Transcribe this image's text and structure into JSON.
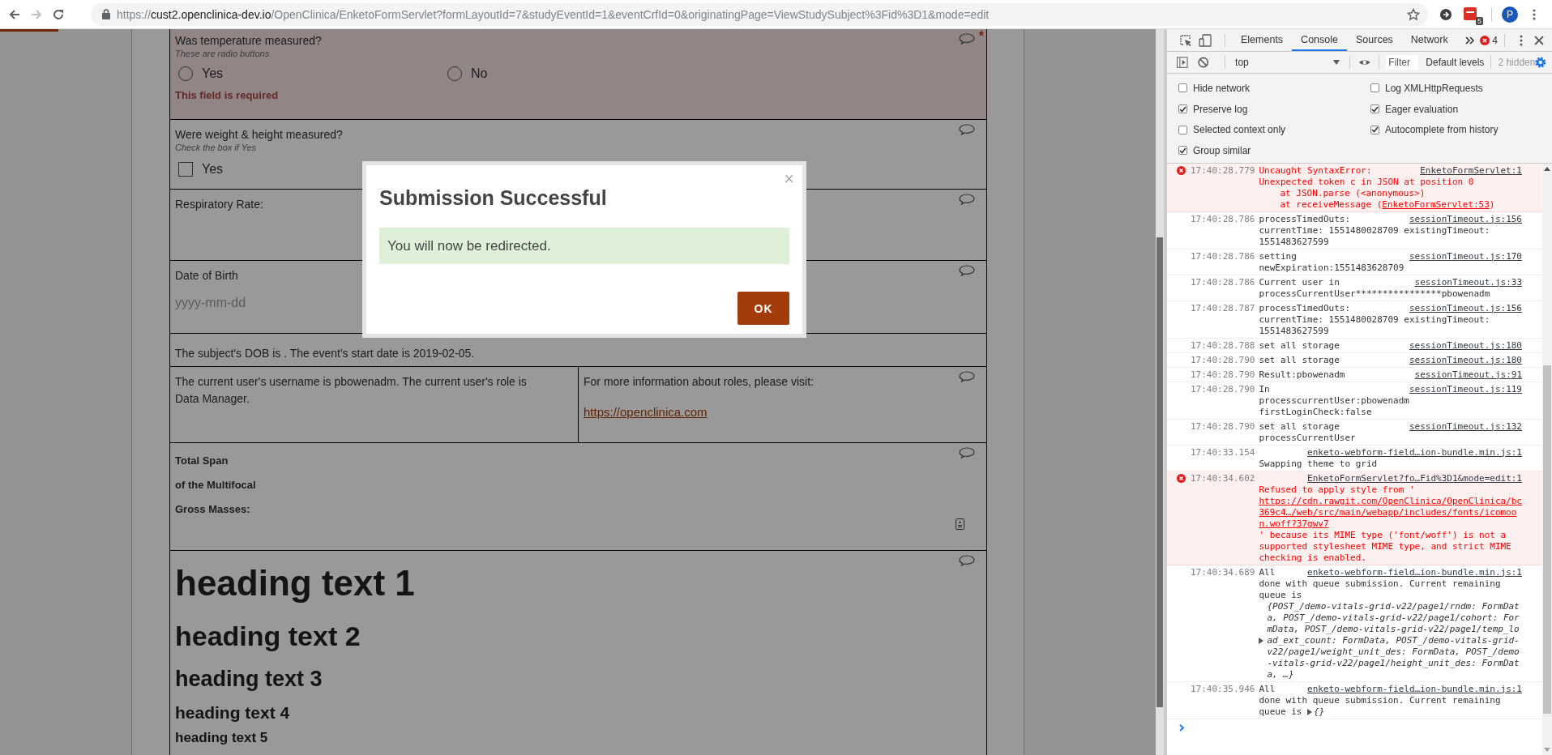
{
  "browser": {
    "url": {
      "scheme": "https://",
      "host": "cust2.openclinica-dev.io",
      "path": "/OpenClinica/EnketoFormServlet?formLayoutId=7&studyEventId=1&eventCrfId=0&originatingPage=ViewStudySubject%3Fid%3D1&mode=edit"
    },
    "extension_badge": "5",
    "profile_initial": "P"
  },
  "form": {
    "rows": [
      {
        "kind": "radio",
        "label": "Was temperature measured?",
        "hint": "These are radio buttons",
        "required_mark": "*",
        "options": [
          {
            "label": "Yes",
            "selected": false
          },
          {
            "label": "No",
            "selected": false
          }
        ],
        "error": "This field is required"
      },
      {
        "kind": "checkbox",
        "label": "Were weight & height measured?",
        "hint": "Check the box if Yes",
        "options": [
          {
            "label": "Yes",
            "checked": false
          }
        ]
      },
      {
        "kind": "text",
        "label": "Respiratory Rate:"
      },
      {
        "kind": "date",
        "label": "Date of Birth",
        "placeholder": "yyyy-mm-dd"
      },
      {
        "kind": "note",
        "text": "The subject's DOB is . The event's start date is 2019-02-05."
      },
      {
        "kind": "columns",
        "left": "The current user's username is pbowenadm. The current user's role is Data Manager.",
        "right": "For more information about roles, please visit:",
        "link": "https://openclinica.com"
      },
      {
        "kind": "bold_lines",
        "lines": [
          "Total Span",
          "of the Multifocal",
          "Gross Masses:"
        ]
      },
      {
        "kind": "headings",
        "headings": [
          "heading text 1",
          "heading text 2",
          "heading text 3",
          "heading text 4",
          "heading text 5"
        ]
      }
    ]
  },
  "modal": {
    "title": "Submission Successful",
    "message": "You will now be redirected.",
    "close": "×",
    "button": "OK"
  },
  "devtools": {
    "tabs": [
      {
        "label": "Elements",
        "selected": false
      },
      {
        "label": "Console",
        "selected": true
      },
      {
        "label": "Sources",
        "selected": false
      },
      {
        "label": "Network",
        "selected": false
      }
    ],
    "error_count": "4",
    "context": "top",
    "filter_placeholder": "Filter",
    "levels": "Default levels",
    "hidden": "2 hidden",
    "settings": [
      {
        "label": "Hide network",
        "checked": false
      },
      {
        "label": "Log XMLHttpRequests",
        "checked": false
      },
      {
        "label": "Preserve log",
        "checked": true
      },
      {
        "label": "Eager evaluation",
        "checked": true
      },
      {
        "label": "Selected context only",
        "checked": false
      },
      {
        "label": "Autocomplete from history",
        "checked": true
      },
      {
        "label": "Group similar",
        "checked": true
      }
    ],
    "messages": [
      {
        "error": true,
        "kind": "plain",
        "time": "17:40:28.779",
        "text": "Uncaught SyntaxError: Unexpected token c in JSON at position 0",
        "source": "EnketoFormServlet:1",
        "stack": [
          {
            "text": "at JSON.parse (<anonymous>)"
          },
          {
            "text": "at receiveMessage (",
            "link": "EnketoFormServlet:53",
            "after": ")"
          }
        ]
      },
      {
        "error": false,
        "kind": "plain",
        "time": "17:40:28.786",
        "text": "processTimedOuts: currentTime: 1551480028709 existingTimeout: 1551483627599",
        "source": "sessionTimeout.js:156"
      },
      {
        "error": false,
        "kind": "plain",
        "time": "17:40:28.786",
        "text": "setting newExpiration:1551483628709",
        "source": "sessionTimeout.js:170"
      },
      {
        "error": false,
        "kind": "plain",
        "time": "17:40:28.786",
        "text": "Current user in processCurrentUser****************pbowenadm",
        "source": "sessionTimeout.js:33"
      },
      {
        "error": false,
        "kind": "plain",
        "time": "17:40:28.787",
        "text": "processTimedOuts: currentTime: 1551480028709 existingTimeout: 1551483627599",
        "source": "sessionTimeout.js:156"
      },
      {
        "error": false,
        "kind": "plain",
        "time": "17:40:28.788",
        "text": "set all storage",
        "source": "sessionTimeout.js:180"
      },
      {
        "error": false,
        "kind": "plain",
        "time": "17:40:28.790",
        "text": "set all storage",
        "source": "sessionTimeout.js:180"
      },
      {
        "error": false,
        "kind": "plain",
        "time": "17:40:28.790",
        "text": "Result:pbowenadm",
        "source": "sessionTimeout.js:91"
      },
      {
        "error": false,
        "kind": "plain",
        "time": "17:40:28.790",
        "text": "In processcurrentUser:pbowenadm firstLoginCheck:false",
        "source": "sessionTimeout.js:119"
      },
      {
        "error": false,
        "kind": "plain",
        "time": "17:40:28.790",
        "text": "set all storage processCurrentUser",
        "source": "sessionTimeout.js:132"
      },
      {
        "error": false,
        "kind": "plain",
        "time": "17:40:33.154",
        "text": "Swapping theme to grid",
        "source": "enketo-webform-field…ion-bundle.min.js:1"
      },
      {
        "error": true,
        "kind": "linked",
        "time": "17:40:34.602",
        "text": "Refused to apply style from '",
        "link": "https://cdn.rawgit.com/OpenClinica/OpenClinica/bc369c4…/web/src/main/webapp/includes/fonts/icomoon.woff?37gwv7",
        "after": "' because its MIME type ('font/woff') is not a supported stylesheet MIME type, and strict MIME checking is enabled.",
        "source": "EnketoFormServlet?fo…Fid%3D1&mode=edit:1"
      },
      {
        "error": false,
        "kind": "object_block",
        "time": "17:40:34.689",
        "text": "All done with queue submission. Current remaining queue is",
        "object": "{POST_/demo-vitals-grid-v22/page1/rndm: FormData, POST_/demo-vitals-grid-v22/page1/cohort: FormData, POST_/demo-vitals-grid-v22/page1/temp_load_ext_count: FormData, POST_/demo-vitals-grid-v22/page1/weight_unit_des: FormData, POST_/demo-vitals-grid-v22/page1/height_unit_des: FormData, …}",
        "source": "enketo-webform-field…ion-bundle.min.js:1"
      },
      {
        "error": false,
        "kind": "object_inline",
        "time": "17:40:35.946",
        "text": "All done with queue submission. Current remaining queue is",
        "object": "{}",
        "source": "enketo-webform-field…ion-bundle.min.js:1"
      }
    ]
  }
}
